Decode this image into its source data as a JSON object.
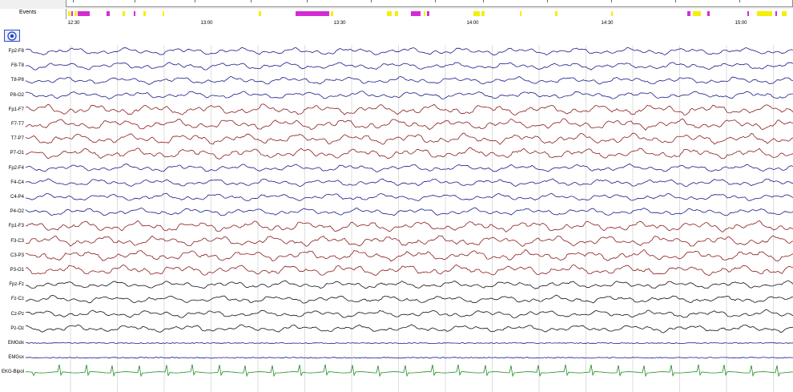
{
  "header": {
    "events_label": "Events",
    "time_labels": [
      "12:30",
      "13:00",
      "13:30",
      "14:00",
      "14:30",
      "15:00"
    ]
  },
  "toolbar": {
    "montage_icon": "target-icon"
  },
  "channels": [
    {
      "label": "Fp2-F8",
      "color": "#1a1a8c"
    },
    {
      "label": "F8-T8",
      "color": "#1a1a8c"
    },
    {
      "label": "T8-P8",
      "color": "#1a1a8c"
    },
    {
      "label": "P8-O2",
      "color": "#1a1a8c"
    },
    {
      "label": "Fp1-F7",
      "color": "#8b1a1a"
    },
    {
      "label": "F7-T7",
      "color": "#8b1a1a"
    },
    {
      "label": "T7-P7",
      "color": "#8b1a1a"
    },
    {
      "label": "P7-O1",
      "color": "#8b1a1a"
    },
    {
      "label": "Fp2-F4",
      "color": "#1a1a8c"
    },
    {
      "label": "F4-C4",
      "color": "#1a1a8c"
    },
    {
      "label": "C4-P4",
      "color": "#1a1a8c"
    },
    {
      "label": "P4-O2",
      "color": "#1a1a8c"
    },
    {
      "label": "Fp1-F3",
      "color": "#8b1a1a"
    },
    {
      "label": "F3-C3",
      "color": "#8b1a1a"
    },
    {
      "label": "C3-P3",
      "color": "#8b1a1a"
    },
    {
      "label": "P3-O1",
      "color": "#8b1a1a"
    },
    {
      "label": "Fpz-Fz",
      "color": "#111111"
    },
    {
      "label": "Fz-Cz",
      "color": "#111111"
    },
    {
      "label": "Cz-Pz",
      "color": "#111111"
    },
    {
      "label": "Pz-Oz",
      "color": "#111111"
    },
    {
      "label": "EMGdx",
      "color": "#1a1a8c"
    },
    {
      "label": "EMGsx",
      "color": "#1a1a8c"
    },
    {
      "label": "EKG-Bipol",
      "color": "#1f8a1f"
    }
  ],
  "colors": {
    "event_magenta": "#d62ad6",
    "event_yellow": "#f5f000",
    "grid": "#c8c8c8"
  }
}
